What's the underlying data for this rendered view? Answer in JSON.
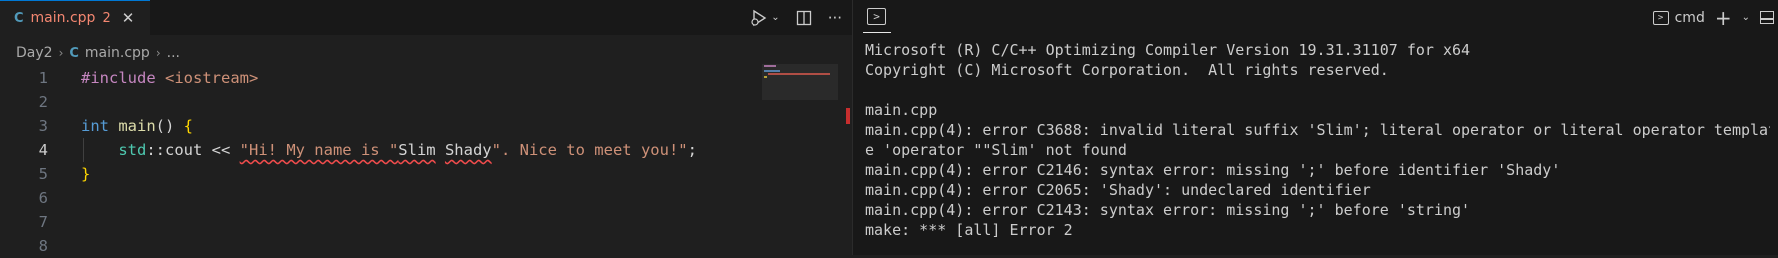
{
  "editor": {
    "tab": {
      "icon": "C",
      "filename": "main.cpp",
      "error_count": "2",
      "close": "✕"
    },
    "actions": {
      "run_icon": "run-debug-icon",
      "split_icon": "split-editor-icon",
      "more": "···"
    },
    "breadcrumb": {
      "folder": "Day2",
      "file": "main.cpp",
      "ellipsis": "..."
    },
    "lines": [
      {
        "number": "1",
        "tokens": [
          {
            "t": "#include",
            "c": "kw-dir"
          },
          {
            "t": " ",
            "c": "txt"
          },
          {
            "t": "<iostream>",
            "c": "inc"
          }
        ]
      },
      {
        "number": "2",
        "tokens": []
      },
      {
        "number": "3",
        "tokens": [
          {
            "t": "int",
            "c": "kw"
          },
          {
            "t": " ",
            "c": "txt"
          },
          {
            "t": "main",
            "c": "fn"
          },
          {
            "t": "() ",
            "c": "txt"
          },
          {
            "t": "{",
            "c": "br"
          }
        ]
      },
      {
        "number": "4",
        "tokens": [
          {
            "t": "    ",
            "c": "txt"
          },
          {
            "t": "std",
            "c": "ns"
          },
          {
            "t": "::cout << ",
            "c": "txt"
          },
          {
            "t": "\"Hi! My name is \"",
            "c": "str squig"
          },
          {
            "t": "Slim",
            "c": "txt squig"
          },
          {
            "t": " ",
            "c": "txt"
          },
          {
            "t": "Shady",
            "c": "txt squig"
          },
          {
            "t": "\". Nice to meet you!\"",
            "c": "str"
          },
          {
            "t": ";",
            "c": "txt"
          }
        ]
      },
      {
        "number": "5",
        "tokens": [
          {
            "t": "}",
            "c": "br"
          }
        ]
      },
      {
        "number": "6",
        "tokens": []
      },
      {
        "number": "7",
        "tokens": []
      },
      {
        "number": "8",
        "tokens": []
      }
    ]
  },
  "terminal": {
    "shell_label": "cmd",
    "add": "+",
    "output_lines": [
      "Microsoft (R) C/C++ Optimizing Compiler Version 19.31.31107 for x64",
      "Copyright (C) Microsoft Corporation.  All rights reserved.",
      "",
      "main.cpp",
      "main.cpp(4): error C3688: invalid literal suffix 'Slim'; literal operator or literal operator templat",
      "e 'operator \"\"Slim' not found",
      "main.cpp(4): error C2146: syntax error: missing ';' before identifier 'Shady'",
      "main.cpp(4): error C2065: 'Shady': undeclared identifier",
      "main.cpp(4): error C2143: syntax error: missing ';' before 'string'",
      "make: *** [all] Error 2"
    ]
  },
  "colors": {
    "error": "#f14c4c",
    "accent": "#0078d4"
  }
}
